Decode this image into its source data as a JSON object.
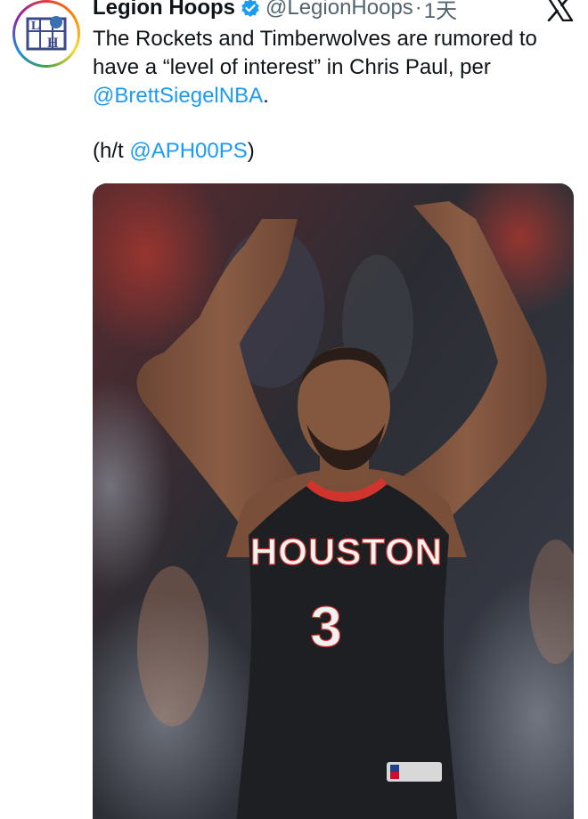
{
  "tweet": {
    "author": {
      "display_name": "Legion Hoops",
      "handle": "@LegionHoops",
      "separator": "·",
      "time": "1天",
      "verified": true,
      "avatar_icon": "legion-hoops-logo"
    },
    "text": {
      "line1": "The Rockets and Timberwolves are rumored to have a “level of interest” in Chris Paul, per ",
      "mention1": "@BrettSiegelNBA",
      "line1_end": ".",
      "line2_prefix": "(h/t ",
      "mention2": "@APH00PS",
      "line2_suffix": ")"
    },
    "media": {
      "jersey_text": "HOUSTON",
      "jersey_number": "3"
    },
    "platform_icon": "x-logo-icon",
    "colors": {
      "link": "#1d9bf0",
      "verified": "#1d9bf0",
      "jersey": "#1e1f23",
      "jersey_trim": "#d0342c"
    }
  }
}
